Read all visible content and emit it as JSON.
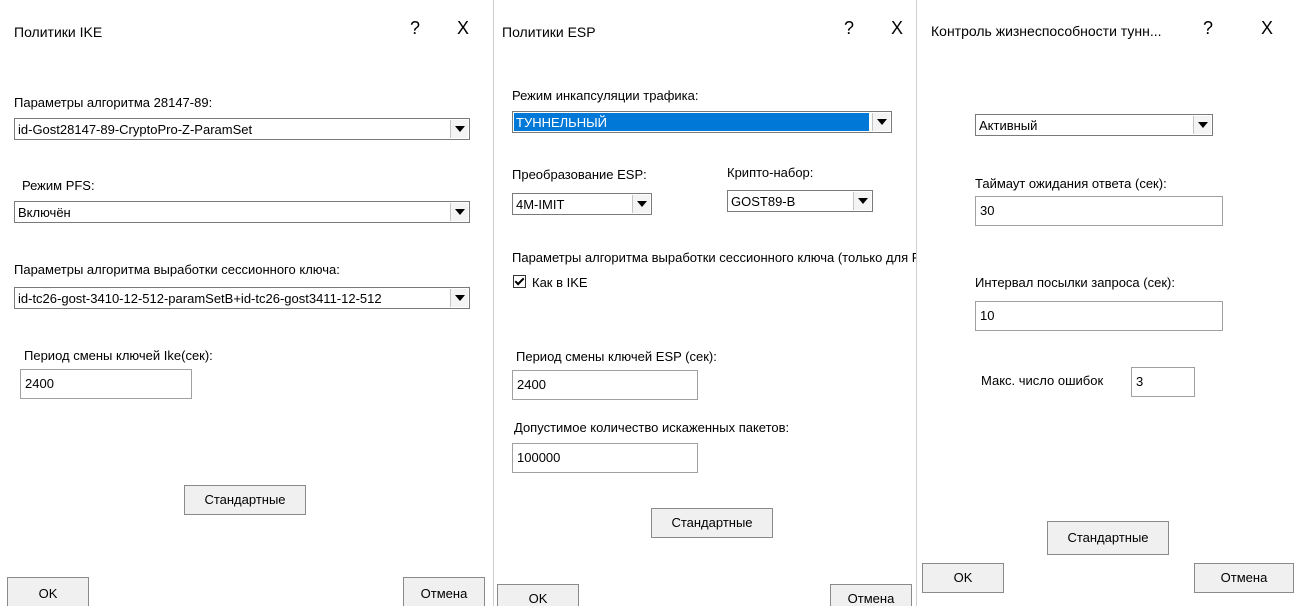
{
  "ike": {
    "title": "Политики IKE",
    "help": "?",
    "close": "X",
    "alg_label": "Параметры алгоритма 28147-89:",
    "alg_value": "id-Gost28147-89-CryptoPro-Z-ParamSet",
    "pfs_label": "Режим PFS:",
    "pfs_value": "Включён",
    "session_label": "Параметры алгоритма выработки сессионного ключа:",
    "session_value": "id-tc26-gost-3410-12-512-paramSetB+id-tc26-gost3411-12-512",
    "period_label": "Период смены ключей Ike(сек):",
    "period_value": "2400",
    "defaults_button": "Стандартные",
    "ok_button": "OK",
    "cancel_button": "Отмена"
  },
  "esp": {
    "title": "Политики ESP",
    "help": "?",
    "close": "X",
    "encap_label": "Режим инкапсуляции трафика:",
    "encap_value": "ТУННЕЛЬНЫЙ",
    "transform_label": "Преобразование ESP:",
    "transform_value": "4M-IMIT",
    "crypto_label": "Крипто-набор:",
    "crypto_value": "GOST89-B",
    "session_label": "Параметры алгоритма выработки сессионного ключа (только для PFS):",
    "as_ike_label": "Как в IKE",
    "period_label": "Период смены ключей ESP (сек):",
    "period_value": "2400",
    "corrupt_label": "Допустимое количество искаженных пакетов:",
    "corrupt_value": "100000",
    "defaults_button": "Стандартные",
    "ok_button": "OK",
    "cancel_button": "Отмена"
  },
  "dpd": {
    "title": "Контроль жизнеспособности тунн...",
    "help": "?",
    "close": "X",
    "mode_value": "Активный",
    "timeout_label": "Таймаут ожидания ответа (сек):",
    "timeout_value": "30",
    "interval_label": "Интервал посылки запроса (сек):",
    "interval_value": "10",
    "max_errors_label": "Макс. число ошибок",
    "max_errors_value": "3",
    "defaults_button": "Стандартные",
    "ok_button": "OK",
    "cancel_button": "Отмена"
  }
}
